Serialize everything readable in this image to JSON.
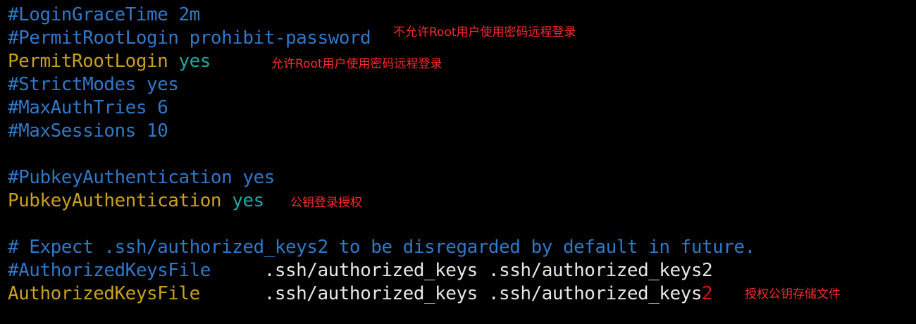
{
  "config_lines": {
    "login_grace_time": "#LoginGraceTime 2m",
    "permit_root_login_comment": "#PermitRootLogin prohibit-password",
    "permit_root_login_key": "PermitRootLogin",
    "permit_root_login_value": "yes",
    "strict_modes": "#StrictModes yes",
    "max_auth_tries": "#MaxAuthTries 6",
    "max_sessions": "#MaxSessions 10",
    "pubkey_auth_comment": "#PubkeyAuthentication yes",
    "pubkey_auth_key": "PubkeyAuthentication",
    "pubkey_auth_value": "yes",
    "expect_comment": "# Expect .ssh/authorized_keys2 to be disregarded by default in future.",
    "authorized_keys_comment_key": "#AuthorizedKeysFile",
    "authorized_keys_comment_value": ".ssh/authorized_keys .ssh/authorized_keys2",
    "authorized_keys_key": "AuthorizedKeysFile",
    "authorized_keys_value": ".ssh/authorized_keys .ssh/authorized_keys",
    "authorized_keys_value_suffix": "2"
  },
  "annotations": {
    "disallow_root_password": "不允许Root用户使用密码远程登录",
    "allow_root_password": "允许Root用户使用密码远程登录",
    "pubkey_login_auth": "公钥登录授权",
    "authorized_keys_storage": "授权公钥存储文件"
  },
  "colors": {
    "background": "#000000",
    "comment": "#2f78c8",
    "directive": "#c8a01e",
    "value_yes": "#1fa7a0",
    "path": "#e6e6e6",
    "annotation": "#ff2a2a"
  }
}
